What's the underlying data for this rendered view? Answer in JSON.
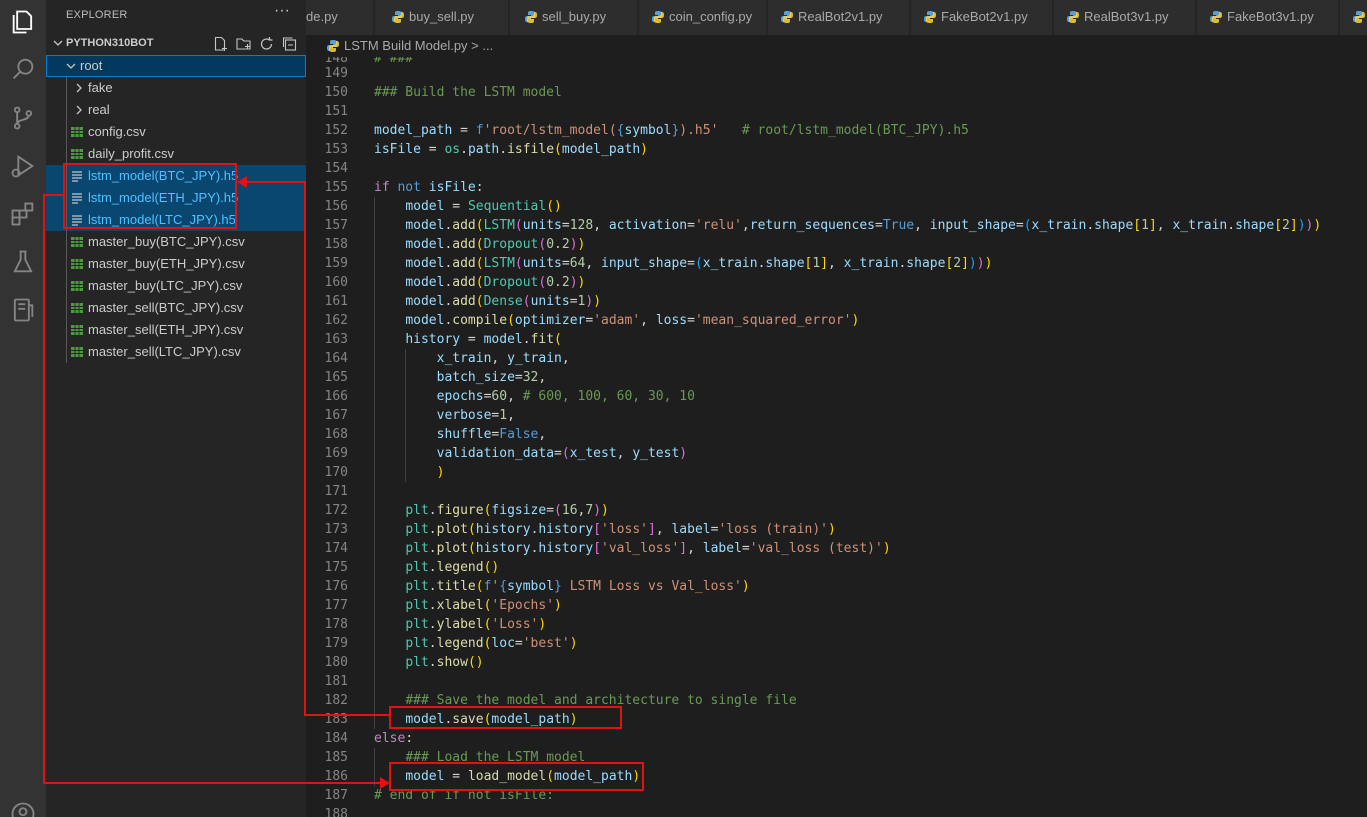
{
  "activity_bar": {
    "icons": [
      "explorer-icon",
      "search-icon",
      "source-control-icon",
      "run-debug-icon",
      "extensions-icon",
      "testing-icon",
      "remote-explorer-icon",
      "account-icon"
    ]
  },
  "sidebar": {
    "title": "EXPLORER",
    "more_label": "···",
    "section_name": "PYTHON310BOT",
    "tree": [
      {
        "label": "root",
        "type": "folder-open"
      },
      {
        "label": "fake",
        "type": "folder"
      },
      {
        "label": "real",
        "type": "folder"
      },
      {
        "label": "config.csv",
        "type": "csv"
      },
      {
        "label": "daily_profit.csv",
        "type": "csv"
      },
      {
        "label": "lstm_model(BTC_JPY).h5",
        "type": "h5"
      },
      {
        "label": "lstm_model(ETH_JPY).h5",
        "type": "h5"
      },
      {
        "label": "lstm_model(LTC_JPY).h5",
        "type": "h5"
      },
      {
        "label": "master_buy(BTC_JPY).csv",
        "type": "csv"
      },
      {
        "label": "master_buy(ETH_JPY).csv",
        "type": "csv"
      },
      {
        "label": "master_buy(LTC_JPY).csv",
        "type": "csv"
      },
      {
        "label": "master_sell(BTC_JPY).csv",
        "type": "csv"
      },
      {
        "label": "master_sell(ETH_JPY).csv",
        "type": "csv"
      },
      {
        "label": "master_sell(LTC_JPY).csv",
        "type": "csv"
      }
    ]
  },
  "tabs": [
    {
      "label": "de.py"
    },
    {
      "label": "buy_sell.py"
    },
    {
      "label": "sell_buy.py"
    },
    {
      "label": "coin_config.py"
    },
    {
      "label": "RealBot2v1.py"
    },
    {
      "label": "FakeBot2v1.py"
    },
    {
      "label": "RealBot3v1.py"
    },
    {
      "label": "FakeBot3v1.py"
    }
  ],
  "breadcrumb": {
    "label": "LSTM Build Model.py > ..."
  },
  "colors": {
    "annotation": "#e11212",
    "accent": "#007fd4"
  }
}
